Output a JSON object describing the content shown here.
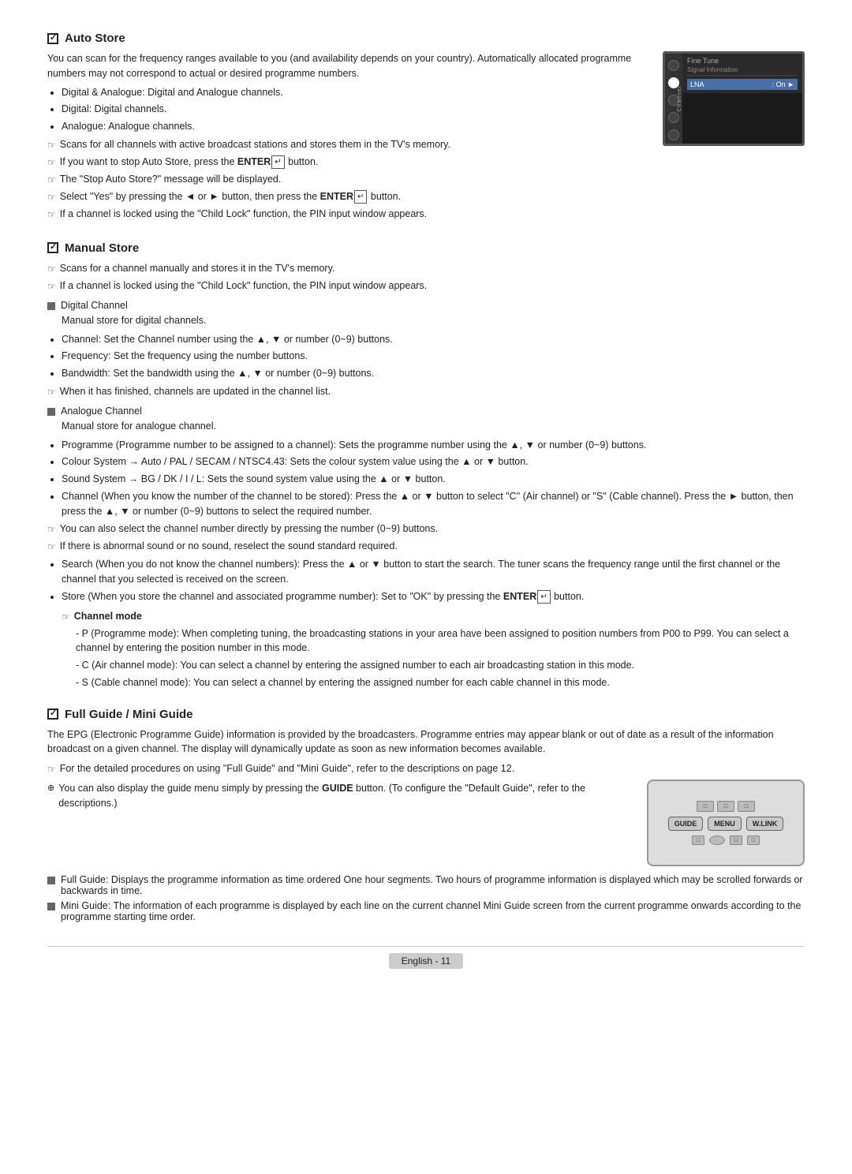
{
  "page": {
    "footer": {
      "label": "English - 11"
    }
  },
  "sections": {
    "auto_store": {
      "title": "Auto Store",
      "intro": "You can scan for the frequency ranges available to you (and availability depends on your country). Automatically allocated programme numbers may not correspond to actual or desired programme numbers.",
      "bullets": [
        "Digital & Analogue: Digital and Analogue channels.",
        "Digital: Digital channels.",
        "Analogue: Analogue channels."
      ],
      "notes": [
        "Scans for all channels with active broadcast stations and stores them in the TV's memory.",
        "If you want to stop Auto Store, press the ENTER button.",
        "The \"Stop Auto Store?\" message will be displayed.",
        "Select \"Yes\" by pressing the ◄ or ► button, then press the ENTER button.",
        "If a channel is locked using the \"Child Lock\" function, the PIN input window appears."
      ],
      "tv": {
        "menu_title": "Fine Tune",
        "menu_sub": "Signal Information",
        "channel_label": "Channel",
        "lna_label": "LNA",
        "lna_value": "On"
      }
    },
    "manual_store": {
      "title": "Manual Store",
      "notes": [
        "Scans for a channel manually and stores it in the TV's memory.",
        "If a channel is locked using the \"Child Lock\" function, the PIN input window appears."
      ],
      "digital_channel": {
        "title": "Digital Channel",
        "subtitle": "Manual store for digital channels.",
        "bullets": [
          "Channel: Set the Channel number using the ▲, ▼ or number (0~9) buttons.",
          "Frequency: Set the frequency using the number buttons.",
          "Bandwidth: Set the bandwidth using the ▲, ▼ or number (0~9) buttons."
        ],
        "note": "When it has finished, channels are updated in the channel list."
      },
      "analogue_channel": {
        "title": "Analogue Channel",
        "subtitle": "Manual store for analogue channel.",
        "bullets": [
          "Programme (Programme number to be assigned to a channel): Sets the programme number using the ▲, ▼ or number (0~9) buttons.",
          "Colour System → Auto / PAL / SECAM / NTSC4.43: Sets the colour system value using the ▲ or ▼ button.",
          "Sound System → BG / DK / I / L: Sets the sound system value using the ▲ or ▼ button.",
          "Channel (When you know the number of the channel to be stored): Press the ▲ or ▼ button to select \"C\" (Air channel) or \"S\" (Cable channel). Press the ► button, then press the ▲, ▼ or number (0~9) buttons to select the required number.",
          "Search (When you do not know the channel numbers): Press the ▲ or ▼ button to start the search. The tuner scans the frequency range until the first channel or the channel that you selected is received on the screen.",
          "Store (When you store the channel and associated programme number): Set to \"OK\" by pressing the ENTER button."
        ],
        "inner_notes": [
          "You can also select the channel number directly by pressing the number (0~9) buttons.",
          "If there is abnormal sound or no sound, reselect the sound standard required."
        ],
        "channel_mode": {
          "label": "Channel mode",
          "items": [
            "P (Programme mode): When completing tuning, the broadcasting stations in your area have been assigned to position numbers from P00 to P99. You can select a channel by entering the position number in this mode.",
            "C (Air channel mode): You can select a channel by entering the assigned number to each air broadcasting station in this mode.",
            "S (Cable channel mode): You can select a channel by entering the assigned number for each cable channel in this mode."
          ]
        }
      }
    },
    "full_mini_guide": {
      "title": "Full Guide / Mini Guide",
      "intro": "The EPG (Electronic Programme Guide) information is provided by the broadcasters. Programme entries may appear blank or out of date as a result of the information broadcast on a given channel. The display will dynamically update as soon as new information becomes available.",
      "notes": [
        "For the detailed procedures on using \"Full Guide\" and \"Mini Guide\", refer to the descriptions on page 12.",
        "You can also display the guide menu simply by pressing the GUIDE button. (To configure the \"Default Guide\", refer to the descriptions.)"
      ],
      "bullets": [
        "Full Guide: Displays the programme information as time ordered One hour segments. Two hours of programme information is displayed which may be scrolled forwards or backwards in time.",
        "Mini Guide: The information of each programme is displayed by each line on the current channel Mini Guide screen from the current programme onwards according to the programme starting time order."
      ],
      "remote": {
        "btn1": "GUIDE",
        "btn2": "MENU",
        "btn3": "W.LINK"
      }
    }
  }
}
